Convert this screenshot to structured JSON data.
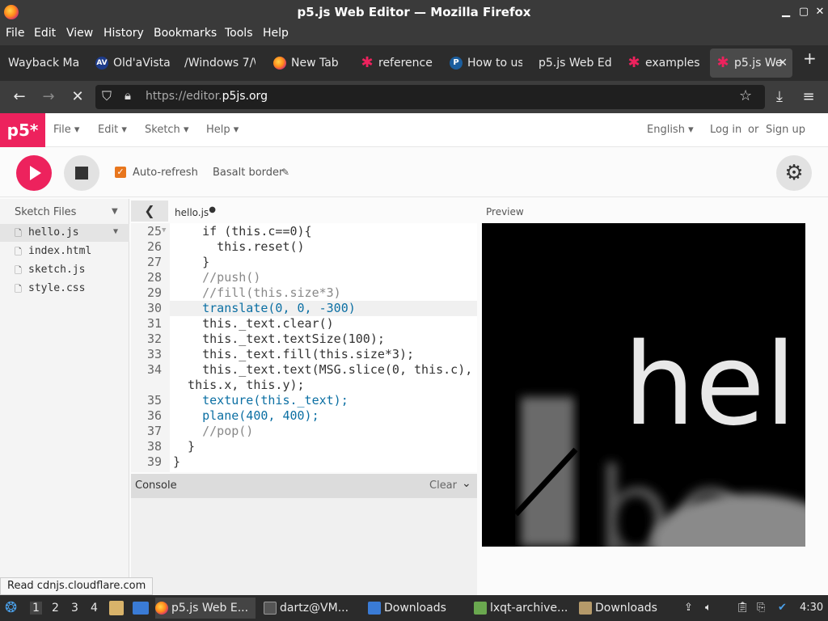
{
  "window": {
    "title": "p5.js Web Editor — Mozilla Firefox"
  },
  "menubar": [
    "File",
    "Edit",
    "View",
    "History",
    "Bookmarks",
    "Tools",
    "Help"
  ],
  "tabs": [
    {
      "label": "Wayback Ma",
      "icon": "wayback-icon"
    },
    {
      "label": "Old'aVista",
      "icon": "aa-icon",
      "glyph": "AV"
    },
    {
      "label": "/Windows 7/\\",
      "icon": "page-icon"
    },
    {
      "label": "New Tab",
      "icon": "firefox-icon"
    },
    {
      "label": "reference",
      "icon": "p5-star-icon"
    },
    {
      "label": "How to us",
      "icon": "p-icon",
      "glyph": "P"
    },
    {
      "label": "p5.js Web Ed",
      "icon": "page-icon"
    },
    {
      "label": "examples",
      "icon": "p5-star-icon"
    },
    {
      "label": "p5.js We",
      "icon": "p5-star-icon",
      "active": true
    }
  ],
  "navbar": {
    "url_prefix": "https://editor.",
    "url_domain": "p5js.org"
  },
  "p5": {
    "logo": "p5*",
    "menu": [
      "File",
      "Edit",
      "Sketch",
      "Help"
    ],
    "language": "English",
    "login": "Log in",
    "or": "or",
    "signup": "Sign up",
    "auto_refresh": "Auto-refresh",
    "sketch_name": "Basalt border",
    "sketch_files_label": "Sketch Files",
    "files": [
      "hello.js",
      "index.html",
      "sketch.js",
      "style.css"
    ],
    "open_file": "hello.js",
    "preview_label": "Preview",
    "console_label": "Console",
    "console_clear": "Clear"
  },
  "code": {
    "line_numbers": [
      "25",
      "26",
      "27",
      "28",
      "29",
      "30",
      "31",
      "32",
      "33",
      "34",
      "",
      "35",
      "36",
      "37",
      "38",
      "39"
    ],
    "lines": [
      "    if (this.c==0){",
      "      this.reset()",
      "    }",
      "    //push()",
      "    //fill(this.size*3)",
      "    translate(0, 0, -300)",
      "    this._text.clear()",
      "    this._text.textSize(100);",
      "    this._text.fill(this.size*3);",
      "    this._text.text(MSG.slice(0, this.c),",
      "  this.x, this.y);",
      "    texture(this._text);",
      "    plane(400, 400);",
      "    //pop()",
      "  }",
      "}"
    ]
  },
  "canvas": {
    "text": "hel"
  },
  "status": "Read cdnjs.cloudflare.com",
  "taskbar": {
    "workspaces": [
      "1",
      "2",
      "3",
      "4"
    ],
    "tasks": [
      "p5.js Web E...",
      "dartz@VM...",
      "Downloads",
      "lxqt-archive...",
      "Downloads"
    ],
    "clock": "4:30"
  }
}
